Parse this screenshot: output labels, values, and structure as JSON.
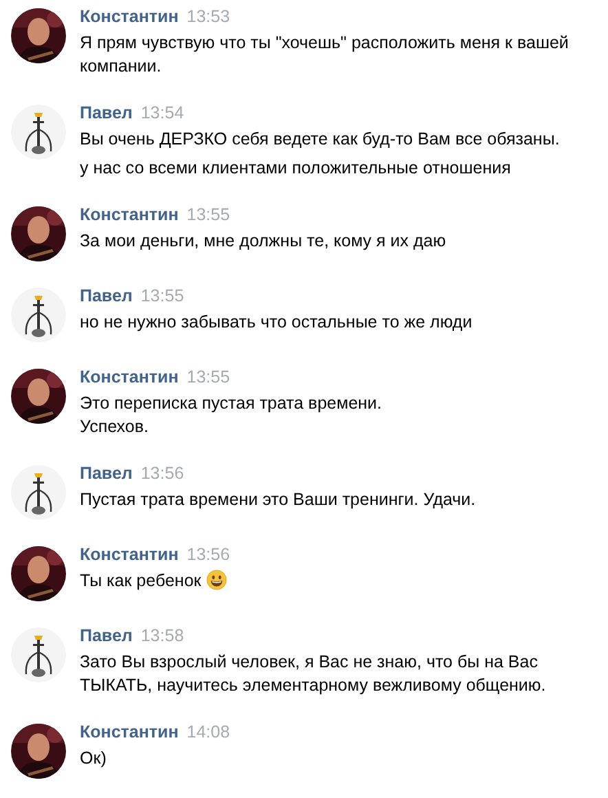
{
  "messages": [
    {
      "author": "Константин",
      "avatar": {
        "kind": "picture"
      },
      "time": "13:53",
      "paragraphs": [
        {
          "text": "Я прям чувствую что ты \"хочешь\" расположить меня к вашей компании."
        }
      ]
    },
    {
      "author": "Павел",
      "avatar": {
        "kind": "hookah"
      },
      "time": "13:54",
      "paragraphs": [
        {
          "text": "Вы очень ДЕРЗКО себя ведете как буд-то Вам все обязаны."
        },
        {
          "text": "у нас со всеми клиентами положительные отношения"
        }
      ]
    },
    {
      "author": "Константин",
      "avatar": {
        "kind": "picture"
      },
      "time": "13:55",
      "paragraphs": [
        {
          "text": "За мои деньги, мне должны те, кому я их даю"
        }
      ]
    },
    {
      "author": "Павел",
      "avatar": {
        "kind": "hookah"
      },
      "time": "13:55",
      "paragraphs": [
        {
          "text": "но не нужно забывать что остальные то же люди"
        }
      ]
    },
    {
      "author": "Константин",
      "avatar": {
        "kind": "picture"
      },
      "time": "13:55",
      "paragraphs": [
        {
          "text": "Это переписка пустая трата времени.\nУспехов."
        }
      ]
    },
    {
      "author": "Павел",
      "avatar": {
        "kind": "hookah"
      },
      "time": "13:56",
      "paragraphs": [
        {
          "text": "Пустая трата времени это Ваши тренинги. Удачи."
        }
      ]
    },
    {
      "author": "Константин",
      "avatar": {
        "kind": "picture"
      },
      "time": "13:56",
      "paragraphs": [
        {
          "text": "Ты как ребенок",
          "emoji": true
        }
      ]
    },
    {
      "author": "Павел",
      "avatar": {
        "kind": "hookah"
      },
      "time": "13:58",
      "paragraphs": [
        {
          "text": "Зато Вы взрослый человек, я Вас не знаю, что бы на Вас ТЫКАТЬ, научитесь элементарному вежливому общению."
        }
      ]
    },
    {
      "author": "Константин",
      "avatar": {
        "kind": "picture"
      },
      "time": "14:08",
      "paragraphs": [
        {
          "text": "Ок)"
        }
      ]
    }
  ]
}
